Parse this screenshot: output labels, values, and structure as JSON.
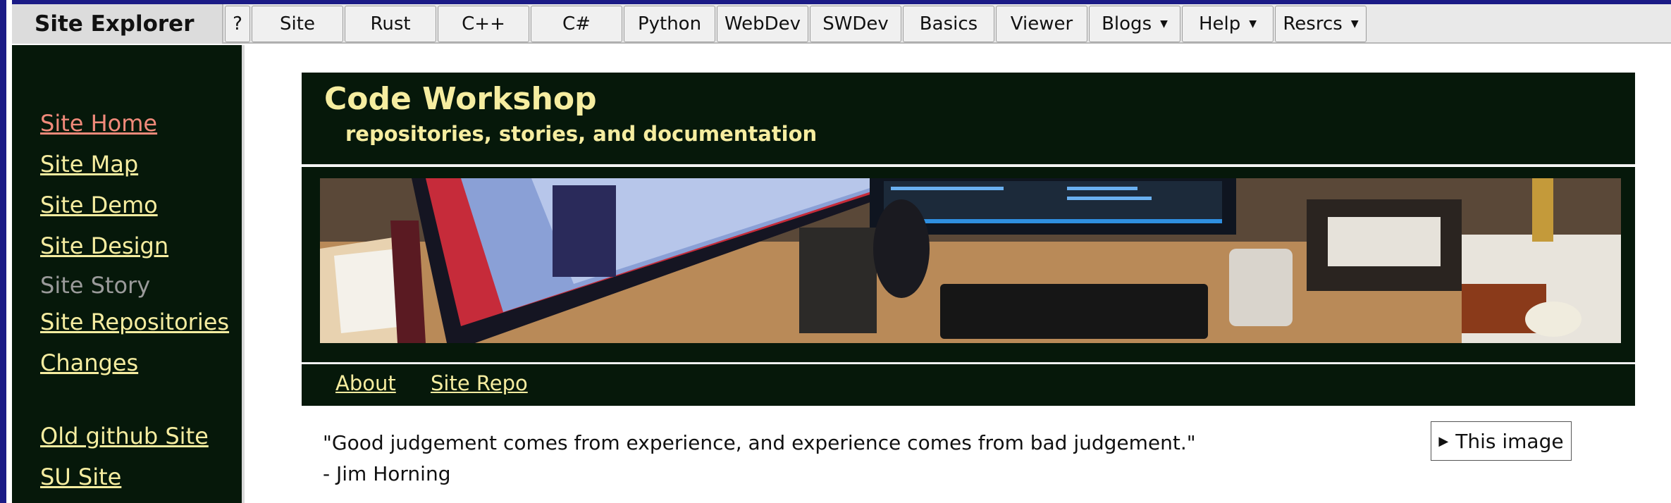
{
  "topbar": {
    "brand": "Site Explorer",
    "buttons": [
      {
        "label": "?",
        "dropdown": false
      },
      {
        "label": "Site",
        "dropdown": false
      },
      {
        "label": "Rust",
        "dropdown": false
      },
      {
        "label": "C++",
        "dropdown": false
      },
      {
        "label": "C#",
        "dropdown": false
      },
      {
        "label": "Python",
        "dropdown": false
      },
      {
        "label": "WebDev",
        "dropdown": false
      },
      {
        "label": "SWDev",
        "dropdown": false
      },
      {
        "label": "Basics",
        "dropdown": false
      },
      {
        "label": "Viewer",
        "dropdown": false
      },
      {
        "label": "Blogs",
        "dropdown": true
      },
      {
        "label": "Help",
        "dropdown": true
      },
      {
        "label": "Resrcs",
        "dropdown": true
      }
    ],
    "caret": "▼"
  },
  "sidebar": {
    "links": [
      {
        "label": "Site Home",
        "state": "active"
      },
      {
        "label": "Site Map",
        "state": "link"
      },
      {
        "label": "Site Demo",
        "state": "link"
      },
      {
        "label": "Site Design",
        "state": "link"
      },
      {
        "label": "Site Story",
        "state": "muted"
      },
      {
        "label": "Site Repositories",
        "state": "link"
      },
      {
        "label": "Changes",
        "state": "link"
      },
      {
        "label": "Old github Site",
        "state": "link"
      },
      {
        "label": "SU Site",
        "state": "link"
      }
    ]
  },
  "header": {
    "title": "Code Workshop",
    "subtitle": "repositories, stories, and documentation"
  },
  "subnav": {
    "links": [
      "About",
      "Site Repo"
    ]
  },
  "quote": {
    "text": "\"Good judgement comes from experience, and experience comes from bad judgement.\"",
    "author": "- Jim Horning"
  },
  "image_button": {
    "icon": "▶",
    "label": "This image"
  },
  "colors": {
    "dark_green": "#06180a",
    "link_cream": "#f6eda0",
    "active_link": "#f08a7a",
    "muted_link": "#9a9a9a",
    "frame_blue": "#1b1b86"
  }
}
